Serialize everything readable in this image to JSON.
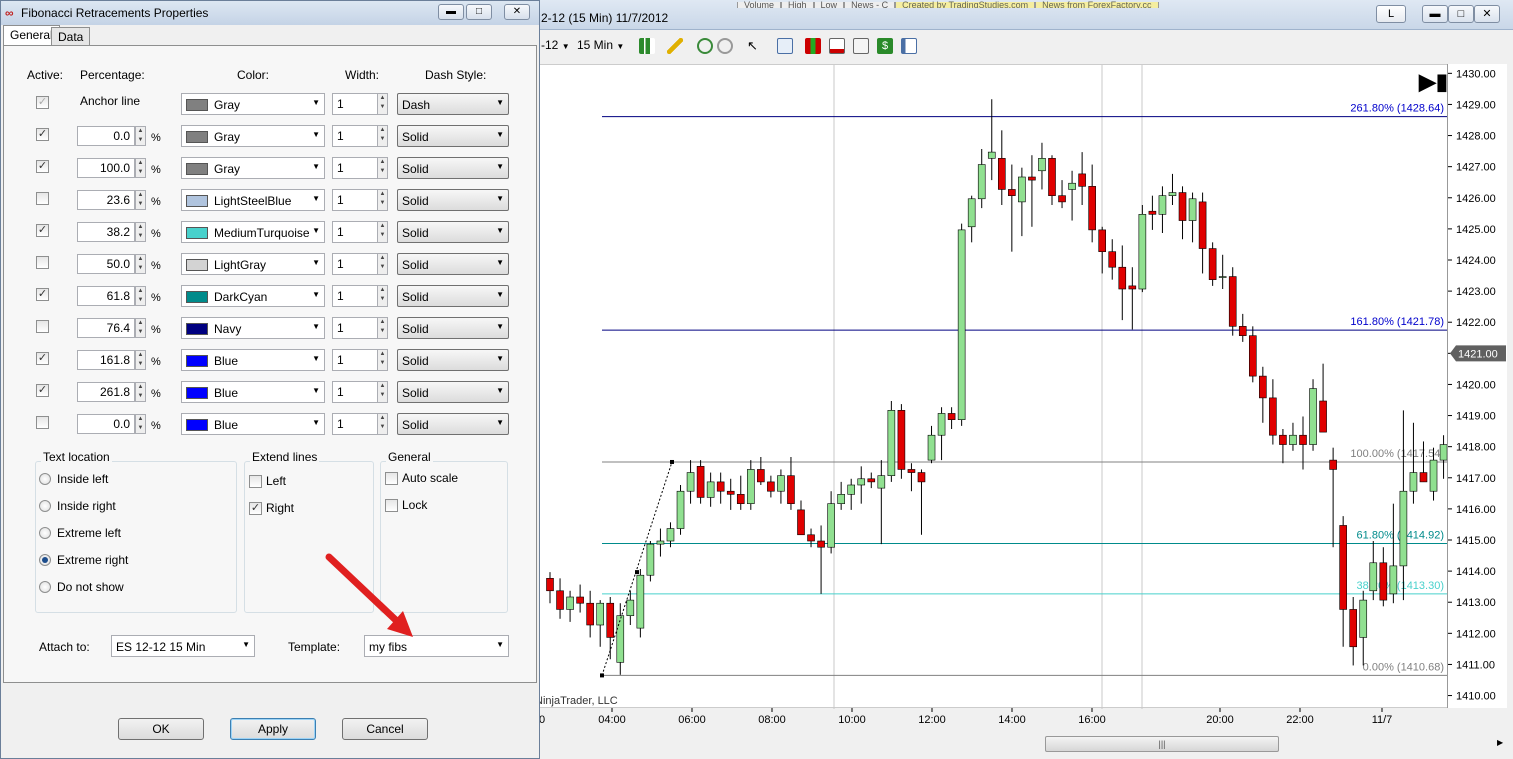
{
  "dialog": {
    "title": "Fibonacci Retracements Properties",
    "tabs": [
      "General",
      "Data"
    ],
    "headers": {
      "active": "Active:",
      "percentage": "Percentage:",
      "color": "Color:",
      "width": "Width:",
      "dash": "Dash Style:"
    },
    "anchor_label": "Anchor line",
    "pct_suffix": "%",
    "rows": [
      {
        "active": true,
        "disabled": true,
        "pct": null,
        "color": "Gray",
        "hex": "#808080",
        "width": "1",
        "dash": "Dash"
      },
      {
        "active": true,
        "pct": "0.0",
        "color": "Gray",
        "hex": "#808080",
        "width": "1",
        "dash": "Solid"
      },
      {
        "active": true,
        "pct": "100.0",
        "color": "Gray",
        "hex": "#808080",
        "width": "1",
        "dash": "Solid"
      },
      {
        "active": false,
        "pct": "23.6",
        "color": "LightSteelBlue",
        "hex": "#b0c4de",
        "width": "1",
        "dash": "Solid"
      },
      {
        "active": true,
        "pct": "38.2",
        "color": "MediumTurquoise",
        "hex": "#48d1cc",
        "width": "1",
        "dash": "Solid"
      },
      {
        "active": false,
        "pct": "50.0",
        "color": "LightGray",
        "hex": "#d3d3d3",
        "width": "1",
        "dash": "Solid"
      },
      {
        "active": true,
        "pct": "61.8",
        "color": "DarkCyan",
        "hex": "#008b8b",
        "width": "1",
        "dash": "Solid"
      },
      {
        "active": false,
        "pct": "76.4",
        "color": "Navy",
        "hex": "#000080",
        "width": "1",
        "dash": "Solid"
      },
      {
        "active": true,
        "pct": "161.8",
        "color": "Blue",
        "hex": "#0000ff",
        "width": "1",
        "dash": "Solid"
      },
      {
        "active": true,
        "pct": "261.8",
        "color": "Blue",
        "hex": "#0000ff",
        "width": "1",
        "dash": "Solid"
      },
      {
        "active": false,
        "pct": "0.0",
        "color": "Blue",
        "hex": "#0000ff",
        "width": "1",
        "dash": "Solid"
      }
    ],
    "text_location": {
      "title": "Text location",
      "options": [
        "Inside left",
        "Inside right",
        "Extreme left",
        "Extreme right",
        "Do not show"
      ],
      "selected": "Extreme right"
    },
    "extend_lines": {
      "title": "Extend lines",
      "options": [
        {
          "label": "Left",
          "checked": false
        },
        {
          "label": "Right",
          "checked": true
        }
      ]
    },
    "general": {
      "title": "General",
      "options": [
        {
          "label": "Auto scale",
          "checked": false
        },
        {
          "label": "Lock",
          "checked": false
        }
      ]
    },
    "attach_to": {
      "label": "Attach to:",
      "value": "ES 12-12 15 Min"
    },
    "template": {
      "label": "Template:",
      "value": "my fibs"
    },
    "buttons": {
      "ok": "OK",
      "apply": "Apply",
      "cancel": "Cancel"
    }
  },
  "chart": {
    "title": "2-12 (15 Min)  11/7/2012",
    "bg_tabs": [
      "Volume",
      "High",
      "Low",
      "News - C",
      "Created by TradingStudies.com",
      "News from ForexFactory.cc"
    ],
    "link_button": "L",
    "toolbar": {
      "instrument_suffix": "-12",
      "interval": "15 Min"
    },
    "copyright": "NinjaTrader, LLC",
    "current_price": "1421.00",
    "price_ticks": [
      "1430.00",
      "1429.00",
      "1428.00",
      "1427.00",
      "1426.00",
      "1425.00",
      "1424.00",
      "1423.00",
      "1422.00",
      "1421.00",
      "1420.00",
      "1419.00",
      "1418.00",
      "1417.00",
      "1416.00",
      "1415.00",
      "1414.00",
      "1413.00",
      "1412.00",
      "1411.00",
      "1410.00"
    ],
    "time_ticks": [
      "0",
      "04:00",
      "06:00",
      "08:00",
      "10:00",
      "12:00",
      "14:00",
      "16:00",
      "18:00",
      "20:00",
      "22:00",
      "11/7"
    ],
    "fib_levels": [
      {
        "label": "261.80% (1428.64)",
        "price": 1428.64,
        "color": "#000080",
        "text_color": "#0000cc"
      },
      {
        "label": "161.80% (1421.78)",
        "price": 1421.78,
        "color": "#000080",
        "text_color": "#0000cc"
      },
      {
        "label": "100.00% (1417.54)",
        "price": 1417.54,
        "color": "#808080",
        "text_color": "#808080"
      },
      {
        "label": "61.80% (1414.92)",
        "price": 1414.92,
        "color": "#008b8b",
        "text_color": "#008b8b"
      },
      {
        "label": "38.20% (1413.30)",
        "price": 1413.3,
        "color": "#48d1cc",
        "text_color": "#48d1cc"
      },
      {
        "label": "0.00% (1410.68)",
        "price": 1410.68,
        "color": "#808080",
        "text_color": "#808080"
      }
    ],
    "up_color": "#90e090",
    "down_color": "#e00000",
    "candles": [
      [
        1413.8,
        1414.0,
        1413.0,
        1413.4
      ],
      [
        1413.4,
        1413.8,
        1412.5,
        1412.8
      ],
      [
        1412.8,
        1413.4,
        1412.4,
        1413.2
      ],
      [
        1413.2,
        1413.6,
        1412.7,
        1413.0
      ],
      [
        1413.0,
        1413.4,
        1411.9,
        1412.3
      ],
      [
        1412.3,
        1413.1,
        1411.6,
        1413.0
      ],
      [
        1413.0,
        1413.2,
        1411.2,
        1411.9
      ],
      [
        1411.1,
        1413.0,
        1410.7,
        1412.6
      ],
      [
        1412.6,
        1413.4,
        1412.3,
        1413.1
      ],
      [
        1412.2,
        1414.1,
        1411.9,
        1413.9
      ],
      [
        1413.9,
        1415.0,
        1413.7,
        1414.9
      ],
      [
        1414.9,
        1415.4,
        1414.5,
        1415.0
      ],
      [
        1415.0,
        1415.6,
        1414.8,
        1415.4
      ],
      [
        1415.4,
        1416.8,
        1415.2,
        1416.6
      ],
      [
        1416.6,
        1417.6,
        1416.2,
        1417.2
      ],
      [
        1417.4,
        1417.6,
        1416.2,
        1416.4
      ],
      [
        1416.4,
        1417.2,
        1416.1,
        1416.9
      ],
      [
        1416.9,
        1417.2,
        1416.2,
        1416.6
      ],
      [
        1416.6,
        1417.0,
        1416.0,
        1416.5
      ],
      [
        1416.5,
        1417.1,
        1416.0,
        1416.2
      ],
      [
        1416.2,
        1417.6,
        1416.0,
        1417.3
      ],
      [
        1417.3,
        1417.7,
        1416.8,
        1416.9
      ],
      [
        1416.9,
        1417.1,
        1416.4,
        1416.6
      ],
      [
        1416.6,
        1417.3,
        1416.2,
        1417.1
      ],
      [
        1417.1,
        1417.7,
        1416.0,
        1416.2
      ],
      [
        1416.0,
        1416.3,
        1415.2,
        1415.2
      ],
      [
        1415.2,
        1415.4,
        1414.8,
        1415.0
      ],
      [
        1415.0,
        1415.5,
        1413.3,
        1414.8
      ],
      [
        1414.8,
        1416.6,
        1414.6,
        1416.2
      ],
      [
        1416.2,
        1416.9,
        1416.0,
        1416.5
      ],
      [
        1416.5,
        1417.0,
        1416.0,
        1416.8
      ],
      [
        1416.8,
        1417.4,
        1416.2,
        1417.0
      ],
      [
        1417.0,
        1417.2,
        1416.7,
        1416.9
      ],
      [
        1416.7,
        1417.6,
        1414.9,
        1417.1
      ],
      [
        1417.1,
        1419.5,
        1416.9,
        1419.2
      ],
      [
        1419.2,
        1419.4,
        1417.0,
        1417.3
      ],
      [
        1417.3,
        1417.5,
        1416.6,
        1417.2
      ],
      [
        1417.2,
        1417.3,
        1415.2,
        1416.9
      ],
      [
        1417.6,
        1418.7,
        1417.5,
        1418.4
      ],
      [
        1418.4,
        1419.3,
        1417.6,
        1419.1
      ],
      [
        1419.1,
        1419.3,
        1418.6,
        1418.9
      ],
      [
        1418.9,
        1425.2,
        1418.7,
        1425.0
      ],
      [
        1425.1,
        1426.1,
        1424.6,
        1426.0
      ],
      [
        1426.0,
        1427.6,
        1425.7,
        1427.1
      ],
      [
        1427.3,
        1429.2,
        1426.6,
        1427.5
      ],
      [
        1427.3,
        1428.2,
        1425.8,
        1426.3
      ],
      [
        1426.3,
        1427.1,
        1424.3,
        1426.1
      ],
      [
        1425.9,
        1427.0,
        1424.8,
        1426.7
      ],
      [
        1426.7,
        1427.4,
        1425.1,
        1426.6
      ],
      [
        1426.9,
        1427.8,
        1426.3,
        1427.3
      ],
      [
        1427.3,
        1427.4,
        1425.8,
        1426.1
      ],
      [
        1426.1,
        1426.6,
        1425.7,
        1425.9
      ],
      [
        1426.3,
        1426.9,
        1425.3,
        1426.5
      ],
      [
        1426.8,
        1427.5,
        1425.8,
        1426.4
      ],
      [
        1426.4,
        1427.1,
        1424.6,
        1425.0
      ],
      [
        1425.0,
        1425.1,
        1423.6,
        1424.3
      ],
      [
        1424.3,
        1424.7,
        1423.4,
        1423.8
      ],
      [
        1423.8,
        1424.5,
        1422.1,
        1423.1
      ],
      [
        1423.2,
        1423.8,
        1421.8,
        1423.1
      ],
      [
        1423.1,
        1425.8,
        1423.0,
        1425.5
      ],
      [
        1425.6,
        1426.1,
        1425.0,
        1425.5
      ],
      [
        1425.5,
        1426.4,
        1424.9,
        1426.1
      ],
      [
        1426.1,
        1426.8,
        1425.8,
        1426.2
      ],
      [
        1426.2,
        1426.4,
        1424.7,
        1425.3
      ],
      [
        1425.3,
        1426.2,
        1424.6,
        1426.0
      ],
      [
        1425.9,
        1426.2,
        1423.6,
        1424.4
      ],
      [
        1424.4,
        1424.6,
        1423.2,
        1423.4
      ],
      [
        1423.5,
        1424.2,
        1423.1,
        1423.5
      ],
      [
        1423.5,
        1423.8,
        1421.6,
        1421.9
      ],
      [
        1421.9,
        1422.3,
        1421.4,
        1421.6
      ],
      [
        1421.6,
        1421.9,
        1420.1,
        1420.3
      ],
      [
        1420.3,
        1420.6,
        1418.8,
        1419.6
      ],
      [
        1419.6,
        1420.2,
        1418.1,
        1418.4
      ],
      [
        1418.4,
        1418.6,
        1417.5,
        1418.1
      ],
      [
        1418.1,
        1418.8,
        1417.9,
        1418.4
      ],
      [
        1418.4,
        1419.0,
        1417.3,
        1418.1
      ],
      [
        1418.1,
        1420.2,
        1417.9,
        1419.9
      ],
      [
        1419.5,
        1420.7,
        1418.6,
        1418.5
      ],
      [
        1417.6,
        1418.0,
        1414.8,
        1417.3
      ],
      [
        1415.5,
        1415.8,
        1411.6,
        1412.8
      ],
      [
        1412.8,
        1413.2,
        1411.0,
        1411.6
      ],
      [
        1411.9,
        1413.4,
        1411.0,
        1413.1
      ],
      [
        1413.4,
        1415.0,
        1413.1,
        1414.3
      ],
      [
        1414.3,
        1414.8,
        1412.9,
        1413.1
      ],
      [
        1413.3,
        1416.2,
        1413.0,
        1414.2
      ],
      [
        1414.2,
        1419.2,
        1413.1,
        1416.6
      ],
      [
        1416.6,
        1418.8,
        1416.2,
        1417.2
      ],
      [
        1417.2,
        1418.2,
        1416.9,
        1416.9
      ],
      [
        1416.6,
        1418.0,
        1416.3,
        1417.6
      ],
      [
        1417.6,
        1418.4,
        1417.0,
        1418.1
      ],
      [
        1418.1,
        1418.8,
        1417.8,
        1418.0
      ],
      [
        1418.4,
        1423.0,
        1418.2,
        1420.8
      ],
      [
        1420.8,
        1421.4,
        1419.6,
        1420.1
      ],
      [
        1419.5,
        1421.5,
        1419.4,
        1421.0
      ]
    ]
  }
}
